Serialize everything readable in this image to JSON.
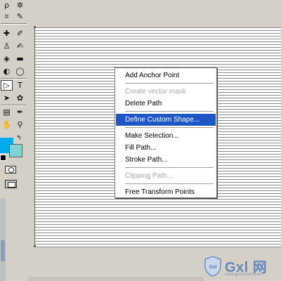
{
  "tools": {
    "rows": [
      {
        "left": "lasso-tool",
        "left_glyph": "ρ",
        "right": "magic-wand-tool",
        "right_glyph": "✲"
      },
      {
        "left": "crop-tool",
        "left_glyph": "⌗",
        "right": "slice-tool",
        "right_glyph": "✎"
      },
      {
        "left": "healing-brush-tool",
        "left_glyph": "✚",
        "right": "brush-tool",
        "right_glyph": "✐"
      },
      {
        "left": "clone-stamp-tool",
        "left_glyph": "♙",
        "right": "history-brush-tool",
        "right_glyph": "✍"
      },
      {
        "left": "eraser-tool",
        "left_glyph": "◈",
        "right": "gradient-tool",
        "right_glyph": "▬"
      },
      {
        "left": "blur-tool",
        "left_glyph": "◐",
        "right": "dodge-tool",
        "right_glyph": "◯"
      },
      {
        "left": "path-selection-tool",
        "left_glyph": "▷",
        "right": "type-tool",
        "right_glyph": "T"
      },
      {
        "left": "direct-selection-tool",
        "left_glyph": "➤",
        "right": "custom-shape-tool",
        "right_glyph": "✿"
      },
      {
        "left": "notes-tool",
        "left_glyph": "▤",
        "right": "eyedropper-tool",
        "right_glyph": "✒"
      },
      {
        "left": "hand-tool",
        "left_glyph": "✋",
        "right": "zoom-tool",
        "right_glyph": "⚲"
      }
    ]
  },
  "colors": {
    "foreground": "#00aaee",
    "background": "#7fd4d0",
    "menu_highlight": "#1e56c8"
  },
  "context_menu": {
    "items": [
      {
        "label": "Add Anchor Point",
        "disabled": false
      },
      {
        "separator": true
      },
      {
        "label": "Create vector mask",
        "disabled": true
      },
      {
        "label": "Delete Path",
        "disabled": false
      },
      {
        "separator": true
      },
      {
        "label": "Define Custom Shape...",
        "disabled": false,
        "highlighted": true
      },
      {
        "separator": true
      },
      {
        "label": "Make Selection...",
        "disabled": false
      },
      {
        "label": "Fill Path...",
        "disabled": false
      },
      {
        "label": "Stroke Path...",
        "disabled": false
      },
      {
        "separator": true
      },
      {
        "label": "Clipping Path...",
        "disabled": true
      },
      {
        "separator": true
      },
      {
        "label": "Free Transform Points",
        "disabled": false
      }
    ]
  },
  "watermark": {
    "brand": "Gxl 网",
    "url": "www.gxlsystem.com",
    "shield_text": "Gxl"
  }
}
